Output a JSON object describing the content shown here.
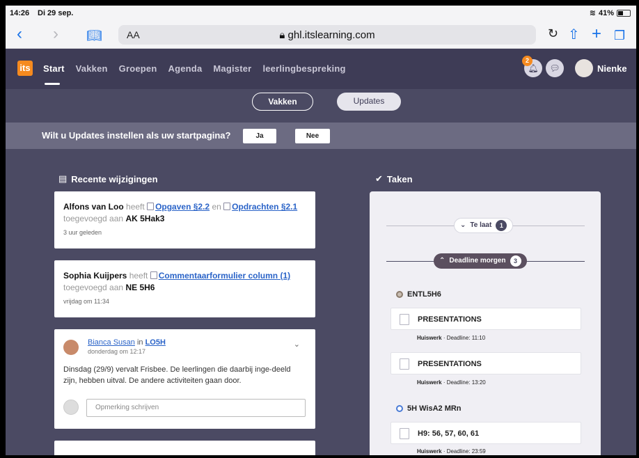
{
  "status": {
    "time": "14:26",
    "date": "Di 29 sep.",
    "battery": "41%"
  },
  "browser": {
    "aa": "AA",
    "url": "ghl.itslearning.com"
  },
  "nav": {
    "logo": "its",
    "items": [
      "Start",
      "Vakken",
      "Groepen",
      "Agenda",
      "Magister",
      "leerlingbespreking"
    ],
    "notification_count": "2",
    "user": "Nienke"
  },
  "toggles": {
    "vakken": "Vakken",
    "updates": "Updates"
  },
  "prompt": {
    "question": "Wilt u Updates instellen als uw startpagina?",
    "yes": "Ja",
    "no": "Nee"
  },
  "recent": {
    "title": "Recente wijzigingen",
    "card1": {
      "name": "Alfons van Loo",
      "heeft": "heeft",
      "link1": "Opgaven §2.2",
      "en": "en",
      "link2": "Opdrachten §2.1",
      "added": "toegevoegd aan",
      "course": "AK 5Hak3",
      "time": "3 uur geleden"
    },
    "card2": {
      "name": "Sophia Kuijpers",
      "heeft": "heeft",
      "link1": "Commentaarformulier column (1)",
      "added": "toegevoegd aan",
      "course": "NE 5H6",
      "time": "vrijdag om 11:34"
    },
    "card3": {
      "name": "Bianca Susan",
      "in": "in",
      "group": "LO5H",
      "time": "donderdag om 12:17",
      "body": "Dinsdag (29/9) vervalt Frisbee. De leerlingen die daarbij inge-deeld zijn, hebben uitval. De andere activiteiten gaan door.",
      "comment_placeholder": "Opmerking schrijven"
    }
  },
  "tasks": {
    "title": "Taken",
    "late": {
      "label": "Te laat",
      "count": "1"
    },
    "tomorrow": {
      "label": "Deadline morgen",
      "count": "3"
    },
    "course1": "ENTL5H6",
    "t1": {
      "title": "PRESENTATIONS",
      "type": "Huiswerk",
      "deadline": "· Deadline: 11:10"
    },
    "t2": {
      "title": "PRESENTATIONS",
      "type": "Huiswerk",
      "deadline": "· Deadline: 13:20"
    },
    "course2": "5H WisA2 MRn",
    "t3": {
      "title": "H9: 56, 57, 60, 61",
      "type": "Huiswerk",
      "deadline": "· Deadline: 23:59"
    }
  }
}
